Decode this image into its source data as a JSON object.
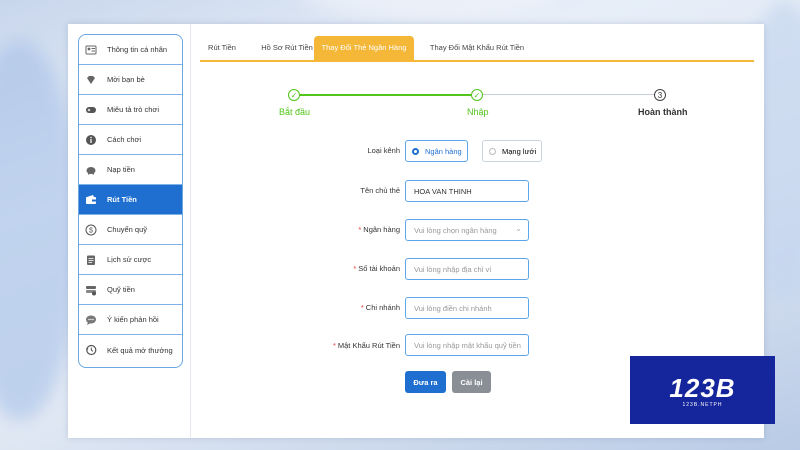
{
  "sidebar": {
    "items": [
      {
        "label": "Thông tin cá nhân",
        "icon": "user-card-icon",
        "active": false
      },
      {
        "label": "Mời bạn bè",
        "icon": "diamond-icon",
        "active": false
      },
      {
        "label": "Miêu tả trò chơi",
        "icon": "gamepad-icon",
        "active": false
      },
      {
        "label": "Cách chơi",
        "icon": "info-icon",
        "active": false
      },
      {
        "label": "Nạp tiền",
        "icon": "piggy-bank-icon",
        "active": false
      },
      {
        "label": "Rút Tiền",
        "icon": "wallet-icon",
        "active": true
      },
      {
        "label": "Chuyển quỹ",
        "icon": "dollar-coin-icon",
        "active": false
      },
      {
        "label": "Lịch sử cược",
        "icon": "clipboard-icon",
        "active": false
      },
      {
        "label": "Quỹ tiền",
        "icon": "money-stack-icon",
        "active": false
      },
      {
        "label": "Ý kiến phản hồi",
        "icon": "chat-bubble-icon",
        "active": false
      },
      {
        "label": "Kết quả mở thưởng",
        "icon": "history-icon",
        "active": false
      }
    ]
  },
  "tabs": [
    {
      "label": "Rút Tiền",
      "active": false
    },
    {
      "label": "Hồ Sơ Rút Tiền",
      "active": false
    },
    {
      "label": "Thay Đổi Thẻ Ngân Hàng",
      "active": true
    },
    {
      "label": "Thay Đổi Mật Khẩu Rút Tiền",
      "active": false
    }
  ],
  "steps": [
    {
      "label": "Bắt đầu",
      "state": "done",
      "mark": "✓"
    },
    {
      "label": "Nhập",
      "state": "done",
      "mark": "✓"
    },
    {
      "label": "Hoàn thành",
      "state": "current",
      "mark": "3"
    }
  ],
  "form": {
    "channel_label": "Loại kênh",
    "channel_options": [
      "Ngân hàng",
      "Mạng lưới"
    ],
    "channel_selected": "Ngân hàng",
    "holder_label": "Tên chủ thẻ",
    "holder_value": "HOA VAN THINH",
    "bank_label": "Ngân hàng",
    "bank_placeholder": "Vui lòng chọn ngân hàng",
    "account_label": "Số tài khoản",
    "account_placeholder": "Vui lòng nhập địa chỉ ví",
    "branch_label": "Chi nhánh",
    "branch_placeholder": "Vui lòng điền chi nhánh",
    "password_label": "Mật Khẩu Rút Tiền",
    "password_placeholder": "Vui lòng nhập mật khẩu quỹ tiền",
    "required_mark": "*"
  },
  "buttons": {
    "submit": "Đưa ra",
    "reset": "Cài lại"
  },
  "logo": {
    "text": "123B",
    "subtext": "123B.NETPH"
  },
  "colors": {
    "primary": "#1e6fd0",
    "tab_accent": "#f5b738",
    "step_done": "#52c41a",
    "logo_bg": "#15259b"
  }
}
